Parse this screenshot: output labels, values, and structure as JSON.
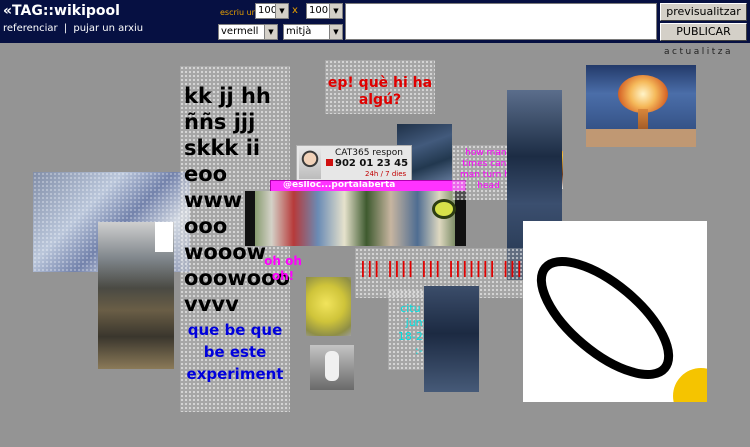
{
  "header": {
    "logo": "«TAG::wikipool",
    "nav": [
      "referenciar",
      "pujar un arxiu"
    ],
    "nav_separator": "|",
    "escriu_label": "escriu un text:",
    "width_value": "100",
    "height_value": "100",
    "x_label": "x",
    "color_value": "vermell",
    "size_value": "mitjà",
    "textarea_value": "",
    "preview_button": "previsualitzar",
    "publish_button": "PUBLICAR",
    "update_link": "actualitza"
  },
  "posts": {
    "big_words": [
      "kk jj hh",
      "ññs jjj",
      "skkk ii",
      "eoo",
      "www",
      "ooo",
      "wooow",
      "ooowooo",
      "vvvv"
    ],
    "blue_text": [
      "que be que",
      "be este",
      "experiment"
    ],
    "red_text": [
      "ep! què hi ha",
      "algú?"
    ],
    "magenta_small": [
      "how many",
      "times can a",
      "man turn his",
      "head"
    ],
    "magenta_oh": [
      "oh oh",
      "oh!"
    ],
    "red_bars": "||| |||| ||| ||||||| |||||| |||",
    "cyan_text": [
      "citu |18",
      "juny |",
      "18-20h |",
      ":-)"
    ],
    "ad_title": "CAT365 respon",
    "ad_phone": "902 01 23 45",
    "ad_hours": "24h / 7 dies",
    "ad_banner": "@eslloc...portalaberta"
  },
  "colors": {
    "background": "#949494",
    "header": "#061042",
    "label_orange": "#e8a000",
    "red": "#e00000",
    "blue": "#0000dd",
    "magenta": "#ff00ff",
    "cyan": "#00e0e0"
  }
}
